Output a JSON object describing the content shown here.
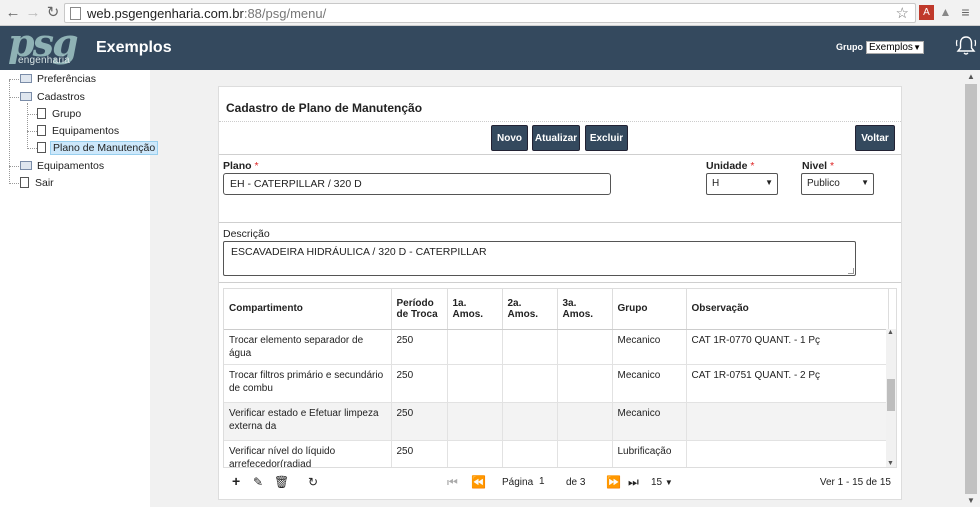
{
  "browser": {
    "url_host": "web.psgengenharia.com.br",
    "url_rest": ":88/psg/menu/"
  },
  "header": {
    "logo_text": "psg",
    "logo_subtext": "engenharia",
    "title": "Exemplos",
    "grupo_label": "Grupo",
    "grupo_value": "Exemplos"
  },
  "sidebar": {
    "items": [
      {
        "label": "Preferências"
      },
      {
        "label": "Cadastros"
      },
      {
        "label": "Grupo"
      },
      {
        "label": "Equipamentos"
      },
      {
        "label": "Plano de Manutenção"
      },
      {
        "label": "Equipamentos"
      },
      {
        "label": "Sair"
      }
    ]
  },
  "form": {
    "title": "Cadastro de Plano de Manutenção",
    "buttons": {
      "novo": "Novo",
      "atualizar": "Atualizar",
      "excluir": "Excluir",
      "voltar": "Voltar"
    },
    "plano_label": "Plano",
    "plano_value": "EH - CATERPILLAR / 320 D",
    "unidade_label": "Unidade",
    "unidade_value": "H",
    "nivel_label": "Nivel",
    "nivel_value": "Publico",
    "required_mark": "*",
    "descricao_label": "Descrição",
    "descricao_value": "ESCAVADEIRA HIDRÁULICA  / 320 D - CATERPILLAR"
  },
  "grid": {
    "columns": [
      "Compartimento",
      "Período de Troca",
      "1a. Amos.",
      "2a. Amos.",
      "3a. Amos.",
      "Grupo",
      "Observação"
    ],
    "rows": [
      [
        "Trocar elemento separador de água",
        "250",
        "",
        "",
        "",
        "Mecanico",
        "CAT 1R-0770 QUANT. - 1 Pç"
      ],
      [
        "Trocar filtros primário e secundário de combu",
        "250",
        "",
        "",
        "",
        "Mecanico",
        "CAT 1R-0751 QUANT. - 2 Pç"
      ],
      [
        "Verificar estado e Efetuar limpeza externa da",
        "250",
        "",
        "",
        "",
        "Mecanico",
        ""
      ],
      [
        "Verificar nível do líquido arrefecedor(radiad",
        "250",
        "",
        "",
        "",
        "Lubrificação",
        ""
      ]
    ]
  },
  "pager": {
    "page_label": "Página",
    "page_value": "1",
    "of_label": "de 3",
    "page_size": "15",
    "summary": "Ver 1 - 15 de 15"
  },
  "icons": {
    "back": "back-arrow-icon",
    "forward": "forward-arrow-icon",
    "reload": "reload-icon",
    "bell": "bell-icon"
  },
  "colors": {
    "header_bg": "#34495e",
    "button_bg": "#34495e",
    "required": "#dd2222",
    "selected_item_bg": "#cde8fb"
  }
}
